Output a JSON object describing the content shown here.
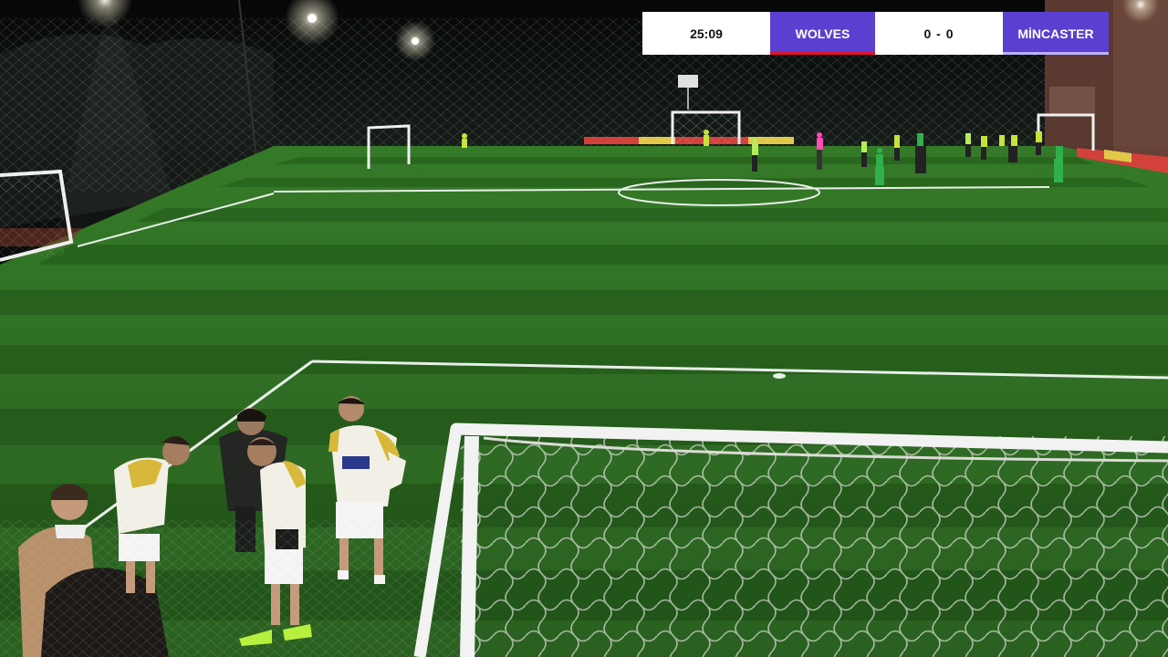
{
  "scoreboard": {
    "clock": "25:09",
    "home_team": "WOLVES",
    "away_team": "MİNCASTER",
    "home_goals": "0",
    "away_goals": "0",
    "score_separator": "-",
    "score_text": "0 - 0"
  },
  "colors": {
    "team_badge": "#5b3fd0",
    "home_accent": "#e0142b",
    "pitch_light": "#3f8b2e",
    "pitch_dark": "#2d6a20",
    "field_lines": "#e8efe8",
    "night_sky": "#0a0d0c"
  },
  "scene": {
    "description_icons": [
      "floodlight-icon",
      "goal-frame-icon",
      "player-figure-icon",
      "net-mesh-icon"
    ]
  }
}
